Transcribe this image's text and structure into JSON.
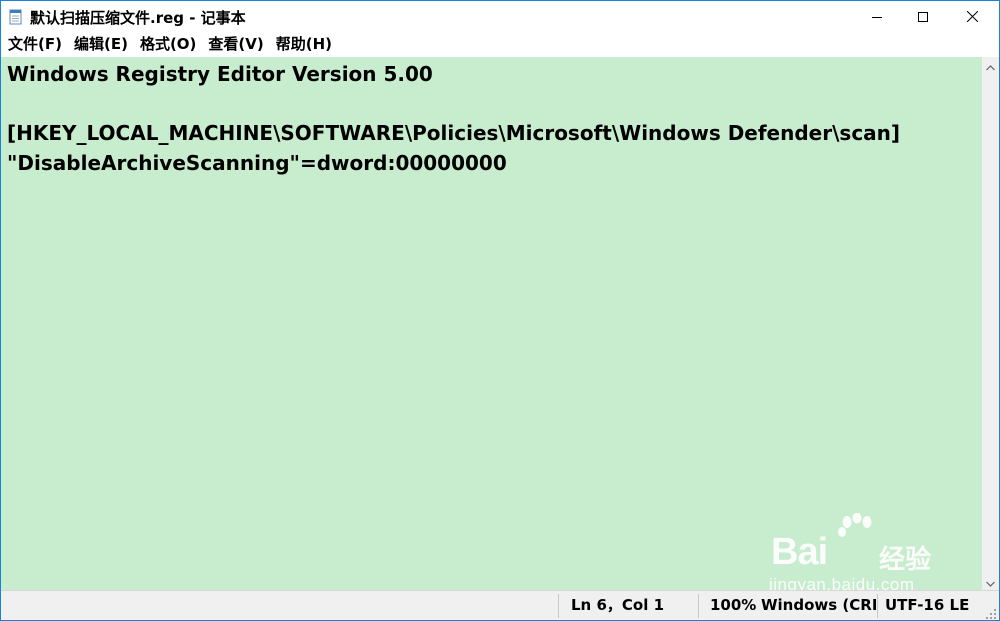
{
  "window": {
    "title": "默认扫描压缩文件.reg - 记事本"
  },
  "menu": {
    "items": [
      "文件(F)",
      "编辑(E)",
      "格式(O)",
      "查看(V)",
      "帮助(H)"
    ]
  },
  "editor": {
    "content": "Windows Registry Editor Version 5.00\n\n[HKEY_LOCAL_MACHINE\\SOFTWARE\\Policies\\Microsoft\\Windows Defender\\scan]\n\"DisableArchiveScanning\"=dword:00000000",
    "background": "#c7ecce"
  },
  "status": {
    "position": "Ln 6，Col 1",
    "zoom": "100%",
    "line_ending": "Windows (CRLF)",
    "encoding": "UTF-16 LE"
  },
  "watermark": {
    "brand": "Bai",
    "sub": "经验",
    "url": "jingyan.baidu.com"
  },
  "icons": {
    "app": "notepad-icon",
    "minimize": "minimize-icon",
    "maximize": "maximize-icon",
    "close": "close-icon",
    "scroll_up": "scroll-up-arrow-icon",
    "scroll_down": "scroll-down-arrow-icon",
    "grip": "resize-grip-icon",
    "paw": "baidu-paw-icon"
  },
  "colors": {
    "accent_border": "#1883d7",
    "statusbar": "#f0f0f0"
  }
}
